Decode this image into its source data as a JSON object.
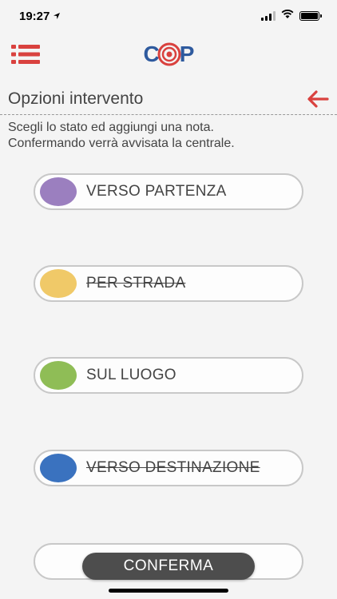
{
  "status_bar": {
    "time": "19:27",
    "location_icon": "location-arrow-icon",
    "signal_icon": "cellular-signal-icon",
    "wifi_icon": "wifi-icon",
    "battery_icon": "battery-icon"
  },
  "header": {
    "menu_icon": "menu-list-icon",
    "logo_text_left": "C",
    "logo_text_right": "P",
    "brand_blue": "#2e5a9e",
    "brand_red": "#d9413e"
  },
  "section": {
    "title": "Opzioni intervento",
    "back_icon": "arrow-left-icon"
  },
  "instructions": {
    "line1": "Scegli lo stato ed aggiungi una nota.",
    "line2": "Confermando verrà avvisata la centrale."
  },
  "options": [
    {
      "label": "VERSO PARTENZA",
      "color": "#9b7fbf",
      "struck": false
    },
    {
      "label": "PER STRADA",
      "color": "#f0c968",
      "struck": true
    },
    {
      "label": "SUL LUOGO",
      "color": "#8fbd56",
      "struck": false
    },
    {
      "label": "VERSO DESTINAZIONE",
      "color": "#3a72bf",
      "struck": true
    }
  ],
  "confirm_button": {
    "label": "CONFERMA"
  }
}
